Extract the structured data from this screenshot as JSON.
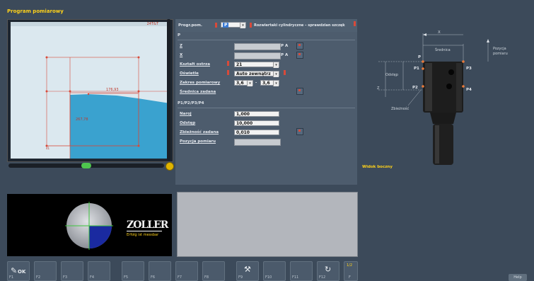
{
  "window": {
    "title": "Program pomiarowy"
  },
  "form": {
    "header_label": "Progr.pom.",
    "program_value": "P",
    "program_desc": "Rozwiertaki cylindryczne – sprawdzian szczęk",
    "section_p": "P",
    "z_label": "Z",
    "x_label": "X",
    "pa_label_1": "P A",
    "pa_label_2": "P A",
    "ksztalt_label": "Kształt ostrza",
    "ksztalt_value": "21",
    "oswietl_label": "Oświetle",
    "oswietl_value": "Auto zewnątrz",
    "zakres_label": "Zakres pomiarowy",
    "zakres_from": "3,6",
    "zakres_sep": "-",
    "zakres_to": "3,6",
    "srednica_label": "Średnica zadana",
    "section_p1": "P1/P2/P3/P4",
    "naroj_label": "Naroj",
    "naroj_value": "1,000",
    "odstep_label": "Odstęp",
    "odstep_value": "10,000",
    "zbieznosc_label": "Zbieżność zadana",
    "zbieznosc_value": "0,010",
    "pozycja_label": "Pozycja pomiaru"
  },
  "viewer": {
    "tag_topright": "24T&T",
    "dim_top": "176,93",
    "dim_mid": "267,78",
    "corner_label": "41"
  },
  "drawing": {
    "x_label": "X",
    "srednica": "Średnica",
    "pozycja_pomiaru_1": "Pozycja",
    "pozycja_pomiaru_2": "pomiaru",
    "p": "P",
    "p1": "P1",
    "p2": "P2",
    "p3": "P3",
    "p4": "P4",
    "odstep": "Odstęp",
    "z": "Z",
    "zbieznosc": "Zbieżność",
    "side_view": "Widok boczny"
  },
  "camera": {
    "brand": "ZOLLER",
    "slogan": "Erfolg ist messbar"
  },
  "toolbar": {
    "ok_label": "OK",
    "keys": [
      "F1",
      "F2",
      "F3",
      "F4",
      "F5",
      "F6",
      "F7",
      "F8",
      "F9",
      "F10",
      "F11",
      "F12"
    ],
    "page_indicator_top": "1/2",
    "page_indicator_bottom": "F",
    "help_label": "Help"
  },
  "colors": {
    "accent_yellow": "#ffd21a",
    "background": "#3c4a5a",
    "panel": "#4d5c6d",
    "measure_red": "#d84a3a",
    "tool_blue": "#3aa2cf"
  }
}
